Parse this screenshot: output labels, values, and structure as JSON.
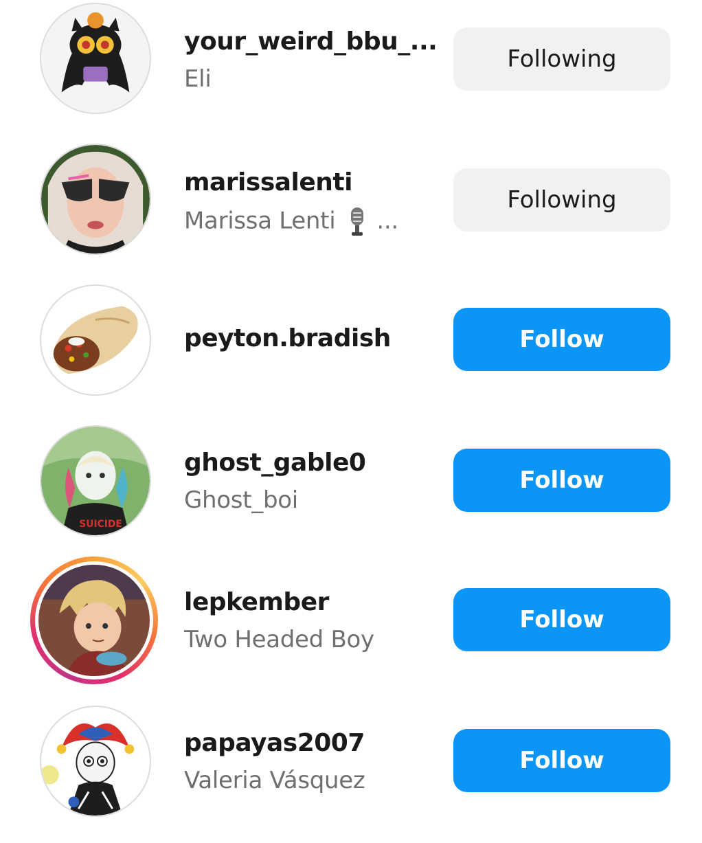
{
  "accounts": [
    {
      "username": "your_weird_bbu_...",
      "full_name": "Eli",
      "button": "Following",
      "state": "following",
      "avatar": "cartoon-demon-icon"
    },
    {
      "username": "marissalenti",
      "full_name": "Marissa Lenti",
      "full_name_suffix": "...",
      "button": "Following",
      "state": "following",
      "avatar": "selfie-photo",
      "name_icon": "microphone-icon"
    },
    {
      "username": "peyton.bradish",
      "full_name": "",
      "button": "Follow",
      "state": "follow",
      "avatar": "burrito-image"
    },
    {
      "username": "ghost_gable0",
      "full_name": "Ghost_boi",
      "button": "Follow",
      "state": "follow",
      "avatar": "cartoon-harley-quinn"
    },
    {
      "username": "lepkember",
      "full_name": "Two Headed Boy",
      "button": "Follow",
      "state": "follow",
      "avatar": "cartoon-boy-with-cup",
      "has_story": true
    },
    {
      "username": "papayas2007",
      "full_name": "Valeria Vásquez",
      "button": "Follow",
      "state": "follow",
      "avatar": "cartoon-jester"
    }
  ],
  "colors": {
    "follow_button": "#0b95f6",
    "following_button": "#f0f1f3",
    "story_ring": [
      "#f9a13a",
      "#e1306c",
      "#c13584"
    ]
  }
}
